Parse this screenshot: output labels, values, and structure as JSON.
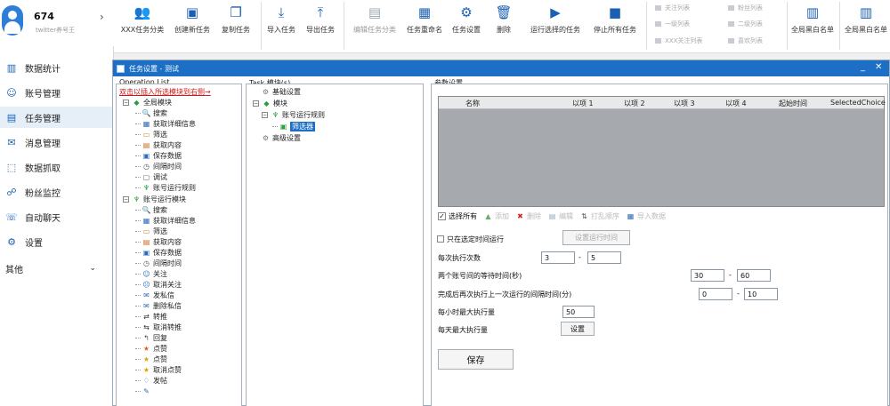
{
  "user": {
    "name": "674",
    "subtitle": "twitter养号王",
    "arrow": "›"
  },
  "sidebar": {
    "items": [
      {
        "label": "数据统计",
        "icon": "bar-chart-icon",
        "glyph": "▥"
      },
      {
        "label": "账号管理",
        "icon": "account-icon",
        "glyph": "☺"
      },
      {
        "label": "任务管理",
        "icon": "task-icon",
        "glyph": "▤"
      },
      {
        "label": "消息管理",
        "icon": "message-icon",
        "glyph": "✉"
      },
      {
        "label": "数据抓取",
        "icon": "grab-icon",
        "glyph": "⬚"
      },
      {
        "label": "粉丝监控",
        "icon": "monitor-icon",
        "glyph": "☍"
      },
      {
        "label": "自动聊天",
        "icon": "chat-icon",
        "glyph": "☏"
      },
      {
        "label": "设置",
        "icon": "gear-icon",
        "glyph": "⚙"
      },
      {
        "label": "其他",
        "icon": "",
        "glyph": ""
      }
    ],
    "other_chevron": "⌄"
  },
  "toolbar": {
    "buttons": [
      {
        "label": "XXX任务分类",
        "icon": "user-group-icon",
        "glyph": "👥"
      },
      {
        "label": "创建新任务",
        "icon": "new-doc-icon",
        "glyph": "▣"
      },
      {
        "label": "复制任务",
        "icon": "copy-icon",
        "glyph": "❐"
      },
      {
        "label": "导入任务",
        "icon": "import-icon",
        "glyph": "⤓"
      },
      {
        "label": "导出任务",
        "icon": "export-icon",
        "glyph": "⤒"
      },
      {
        "label": "编辑任务分类",
        "icon": "edit-doc-icon",
        "glyph": "▤"
      },
      {
        "label": "任务重命名",
        "icon": "calendar-icon",
        "glyph": "▦"
      },
      {
        "label": "任务设置",
        "icon": "gear-icon",
        "glyph": "⚙"
      },
      {
        "label": "删除",
        "icon": "trash-icon",
        "glyph": "🗑"
      },
      {
        "label": "运行选择的任务",
        "icon": "play-icon",
        "glyph": "▶"
      },
      {
        "label": "停止所有任务",
        "icon": "stop-icon",
        "glyph": "■"
      },
      {
        "label": "全局黑白名单",
        "icon": "list-icon",
        "glyph": "▥"
      },
      {
        "label": "全局黑白名单",
        "icon": "list-icon",
        "glyph": "▥"
      }
    ],
    "small": [
      "关注列表",
      "一级列表",
      "XXX关注列表",
      "粉丝列表",
      "二级列表",
      "喜欢列表"
    ]
  },
  "window": {
    "title": "任务设置 - 测试",
    "minimize": "_",
    "maximize": "▫",
    "close": "✕"
  },
  "operation": {
    "label": "Operation List",
    "hint": "双击以插入所选模块到右侧→",
    "groups": [
      {
        "name": "全局模块",
        "items": [
          "搜索",
          "获取详细信息",
          "筛选",
          "获取内容",
          "保存数据",
          "间隔时间",
          "调试",
          "账号运行规则"
        ]
      },
      {
        "name": "账号运行模块",
        "items": [
          "搜索",
          "获取详细信息",
          "筛选",
          "获取内容",
          "保存数据",
          "间隔时间",
          "关注",
          "取消关注",
          "发私信",
          "删除私信",
          "转推",
          "取消转推",
          "回复",
          "点赞",
          "点赞",
          "取消点赞",
          "发帖"
        ]
      }
    ]
  },
  "tasks": {
    "label": "Task 模块(s)",
    "nodes": [
      {
        "label": "基础设置"
      },
      {
        "label": "模块"
      },
      {
        "label": "账号运行规则"
      },
      {
        "label": "筛选器"
      },
      {
        "label": "高级设置"
      }
    ]
  },
  "settings": {
    "label": "参数设置",
    "columns": [
      "名称",
      "以项 1",
      "以项 2",
      "以项 3",
      "以项 4",
      "起始时间",
      "SelectedChoice"
    ],
    "tools": {
      "select_all": "选择所有",
      "add": "添加",
      "delete": "删除",
      "edit": "编辑",
      "shuffle": "打乱顺序",
      "import": "导入数据"
    },
    "schedule_label": "只在选定时间运行",
    "schedule_button": "设置运行时间",
    "each_label": "每次执行次数",
    "each_from": "3",
    "each_to": "5",
    "interval_label": "两个账号间的等待时间(秒)",
    "interval_from": "30",
    "interval_to": "60",
    "rest_label": "完成后再次执行上一次运行的间隔时间(分)",
    "rest_from": "0",
    "rest_to": "10",
    "hourly_label": "每小时最大执行量",
    "hourly_value": "50",
    "daily_label": "每天最大执行量",
    "daily_button": "设置",
    "save": "保存",
    "dash": "-"
  }
}
